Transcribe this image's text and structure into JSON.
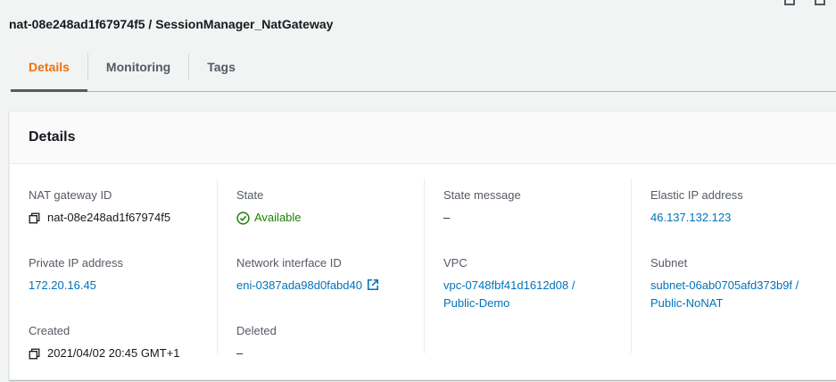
{
  "header": {
    "title": "nat-08e248ad1f67974f5 / SessionManager_NatGateway"
  },
  "tabs": [
    {
      "label": "Details",
      "active": true
    },
    {
      "label": "Monitoring",
      "active": false
    },
    {
      "label": "Tags",
      "active": false
    }
  ],
  "panel": {
    "title": "Details"
  },
  "details": {
    "nat_gateway_id": {
      "label": "NAT gateway ID",
      "value": "nat-08e248ad1f67974f5"
    },
    "private_ip": {
      "label": "Private IP address",
      "value": "172.20.16.45"
    },
    "created": {
      "label": "Created",
      "value": "2021/04/02 20:45 GMT+1"
    },
    "state": {
      "label": "State",
      "value": "Available"
    },
    "network_interface": {
      "label": "Network interface ID",
      "value": "eni-0387ada98d0fabd40"
    },
    "deleted": {
      "label": "Deleted",
      "value": "–"
    },
    "state_message": {
      "label": "State message",
      "value": "–"
    },
    "vpc": {
      "label": "VPC",
      "value_line1": "vpc-0748fbf41d1612d08 /",
      "value_line2": "Public-Demo"
    },
    "elastic_ip": {
      "label": "Elastic IP address",
      "value": "46.137.132.123"
    },
    "subnet": {
      "label": "Subnet",
      "value_line1": "subnet-06ab0705afd373b9f /",
      "value_line2": "Public-NoNAT"
    }
  },
  "colors": {
    "accent_tab": "#ec7211",
    "link": "#0073bb",
    "success": "#1d8102"
  },
  "icons": [
    "copy-icon",
    "status-success-icon",
    "external-link-icon"
  ]
}
